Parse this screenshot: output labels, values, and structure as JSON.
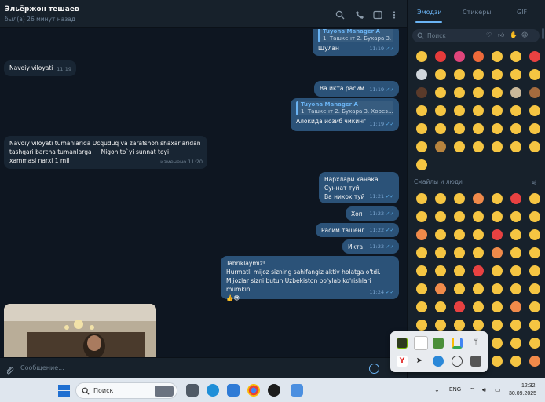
{
  "chat": {
    "name": "Эльёржон тешаев",
    "status": "был(а) 26 минут назад"
  },
  "messages": [
    {
      "text": "Щулан",
      "time": "11:19"
    },
    {
      "text": "Navoiy viloyati",
      "time": "11:19"
    },
    {
      "text": "Ва икта расим",
      "time": "11:19"
    },
    {
      "reply_name": "Tuyona Manager A",
      "reply_text": "1. Ташкент 2. Бухара 3. Хорез...",
      "text": "Алокида йозиб чикинг",
      "time": "11:19"
    },
    {
      "line1": "Navoiy viloyati tumanlarida Ucquduq va zarafshon shaxarlaridan",
      "line2": "tashqari barcha tumanlarga",
      "line2b": "Nigoh to`yi sunnat toyi",
      "line3": "xammasi narxi 1 mil",
      "time": "изменено 11:20"
    },
    {
      "line1": "Нархлари канака",
      "line2": "Суннат туй",
      "line3": "Ва никох туй",
      "time": "11:21"
    },
    {
      "text": "Хоп",
      "time": "11:22"
    },
    {
      "text": "Расим ташенг",
      "time": "11:22"
    },
    {
      "text": "Икта",
      "time": "11:22"
    },
    {
      "line1": "Tabriklaymiz!",
      "line2": "Hurmatli mijoz sizning sahifangiz aktiv holatga o'tdi.",
      "line3": "Mijozlar sizni butun Uzbekiston bo'ylab ko'rishlari mumkin.",
      "emoji": "👍😎",
      "time": "11:24"
    }
  ],
  "top_reply": {
    "reply_name": "Tuyona Manager A",
    "reply_text": "1. Ташкент 2. Бухара 3. ..."
  },
  "composer": {
    "placeholder": "Сообщение..."
  },
  "emoji_panel": {
    "tabs": [
      "Эмодзи",
      "Стикеры",
      "GIF"
    ],
    "search_placeholder": "Поиск",
    "section_title": "Смайлы и люди"
  },
  "taskbar": {
    "search_label": "Поиск",
    "language": "ENG",
    "time": "12:32",
    "date": "30.09.2025"
  },
  "colors": {
    "accent": "#6ab3f3",
    "outgoing": "#2b5278",
    "incoming": "#182533"
  }
}
